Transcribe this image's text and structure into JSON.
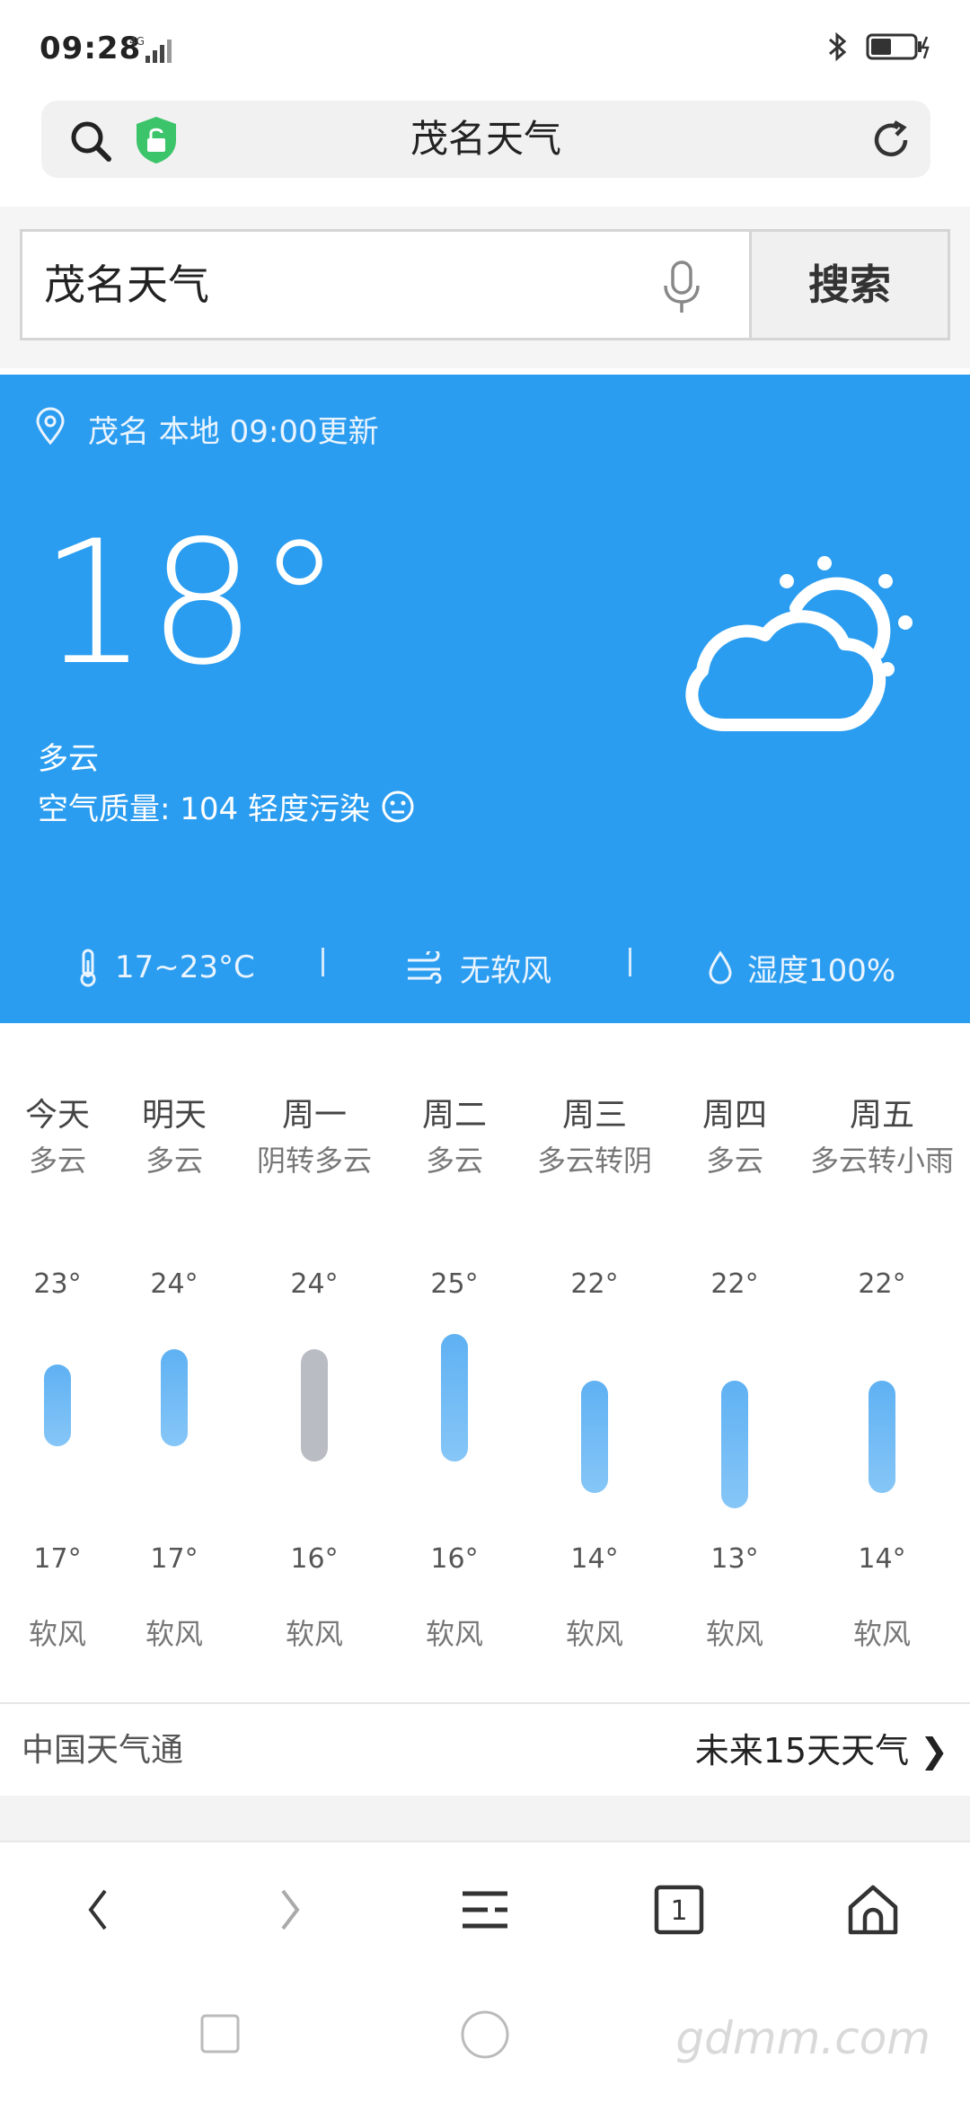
{
  "status": {
    "time": "09:28",
    "network": "4G"
  },
  "url_bar": {
    "title": "茂名天气"
  },
  "search": {
    "query": "茂名天气",
    "button_label": "搜索"
  },
  "current": {
    "location": "茂名 本地 09:00更新",
    "temperature": "18°",
    "condition": "多云",
    "air_quality": "空气质量: 104 轻度污染",
    "temp_range": "17~23°C",
    "wind": "无软风",
    "humidity": "湿度100%"
  },
  "forecast": [
    {
      "day": "今天",
      "desc": "多云",
      "high": 23,
      "low": 17,
      "high_label": "23°",
      "low_label": "17°",
      "wind": "软风",
      "gray": false
    },
    {
      "day": "明天",
      "desc": "多云",
      "high": 24,
      "low": 17,
      "high_label": "24°",
      "low_label": "17°",
      "wind": "软风",
      "gray": false
    },
    {
      "day": "周一",
      "desc": "阴转多云",
      "high": 24,
      "low": 16,
      "high_label": "24°",
      "low_label": "16°",
      "wind": "软风",
      "gray": true
    },
    {
      "day": "周二",
      "desc": "多云",
      "high": 25,
      "low": 16,
      "high_label": "25°",
      "low_label": "16°",
      "wind": "软风",
      "gray": false
    },
    {
      "day": "周三",
      "desc": "多云转阴",
      "high": 22,
      "low": 14,
      "high_label": "22°",
      "low_label": "14°",
      "wind": "软风",
      "gray": false
    },
    {
      "day": "周四",
      "desc": "多云",
      "high": 22,
      "low": 13,
      "high_label": "22°",
      "low_label": "13°",
      "wind": "软风",
      "gray": false
    },
    {
      "day": "周五",
      "desc": "多云转小雨",
      "high": 22,
      "low": 14,
      "high_label": "22°",
      "low_label": "14°",
      "wind": "软风",
      "gray": false
    }
  ],
  "links": {
    "source": "中国天气通",
    "more": "未来15天天气 ❯"
  },
  "browser_nav": {
    "tab_count": "1"
  },
  "watermark": "gdmm.com",
  "colors": {
    "card_blue": "#2b9df0",
    "bar_blue": "#6bb8f5",
    "bar_gray": "#b9bcc2",
    "shield_green": "#3cc46b"
  }
}
